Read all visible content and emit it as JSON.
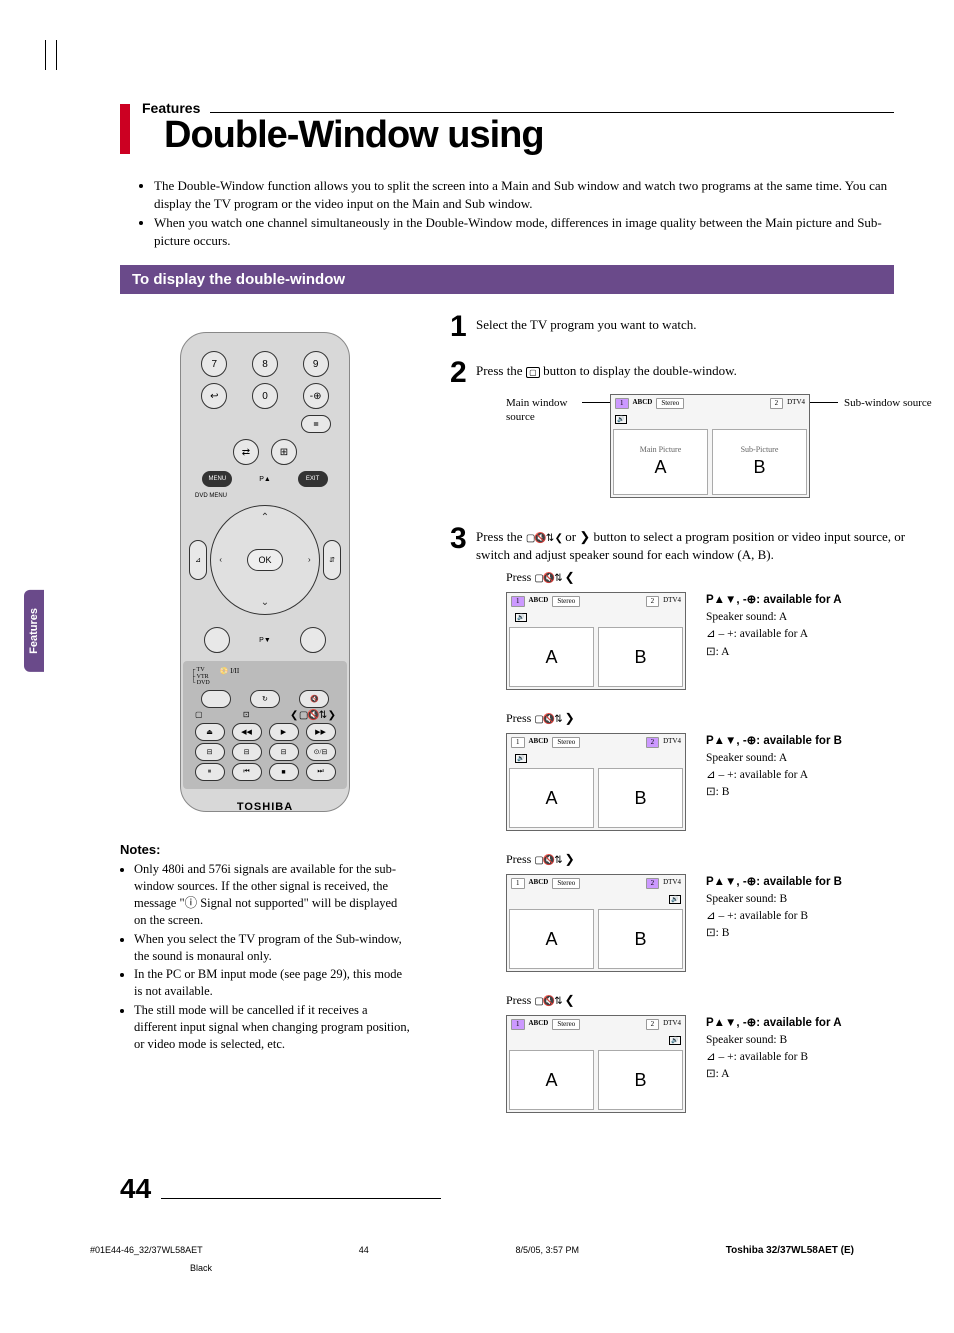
{
  "header": {
    "section_label": "Features",
    "title": "Double-Window using"
  },
  "intro_bullets": [
    "The Double-Window function allows you to split the screen into a Main and Sub window and watch two programs at the same time. You can display the TV program or the video input on the Main and Sub window.",
    "When you watch one channel simultaneously in the Double-Window mode, differences in image quality between the Main picture and Sub-picture occurs."
  ],
  "subheading": "To display the double-window",
  "side_tab": "Features",
  "remote": {
    "digits": [
      "7",
      "8",
      "9",
      "0"
    ],
    "menu": "MENU",
    "exit": "EXIT",
    "dvd_menu": "DVD MENU",
    "ok": "OK",
    "p_up": "P▲",
    "p_down": "P▼",
    "io": "I/II",
    "tv": "TV",
    "vtr": "VTR",
    "dvd": "DVD",
    "brand": "TOSHIBA"
  },
  "notes": {
    "title": "Notes:",
    "items": [
      "Only 480i and 576i signals are available for the sub-window sources. If the other signal is received, the message \"ⓘ Signal not supported\" will be displayed on the screen.",
      "When you select the TV program of the Sub-window, the sound is monaural only.",
      "In the PC or BM input mode (see page 29), this mode is not available.",
      "The still mode will be cancelled if it receives a different input signal when changing program position, or video mode is selected, etc."
    ]
  },
  "steps": {
    "s1": {
      "num": "1",
      "text": "Select the TV program you want to watch."
    },
    "s2": {
      "num": "2",
      "text_before": "Press the ",
      "text_after": " button to display the double-window."
    },
    "s3": {
      "num": "3",
      "text_before": "Press the ",
      "text_mid": " or ",
      "text_after": " button to select a program position or video input source, or switch and adjust speaker sound for each window (A, B)."
    }
  },
  "diagram": {
    "main_label": "Main window source",
    "sub_label": "Sub-window source",
    "main_pic": "Main Picture",
    "sub_pic": "Sub-Picture",
    "A": "A",
    "B": "B",
    "ch1": "1",
    "abcd": "ABCD",
    "stereo": "Stereo",
    "ch2": "2",
    "dtv4": "DTV4"
  },
  "states": [
    {
      "press_dir": "❮",
      "highlight_side": "left",
      "speaker_side": "left",
      "info": {
        "line1": "P▲▼, -⊕: available for A",
        "line2": "Speaker sound: A",
        "line3": "⊿ – +: available for A",
        "line4": "⊡: A"
      }
    },
    {
      "press_dir": "❯",
      "highlight_side": "right",
      "speaker_side": "left",
      "info": {
        "line1": "P▲▼, -⊕: available for B",
        "line2": "Speaker sound: A",
        "line3": "⊿ – +: available for A",
        "line4": "⊡: B"
      }
    },
    {
      "press_dir": "❯",
      "highlight_side": "right",
      "speaker_side": "right",
      "info": {
        "line1": "P▲▼, -⊕: available for B",
        "line2": "Speaker sound: B",
        "line3": "⊿ – +: available for B",
        "line4": "⊡: B"
      }
    },
    {
      "press_dir": "❮",
      "highlight_side": "left",
      "speaker_side": "right",
      "info": {
        "line1": "P▲▼, -⊕: available for A",
        "line2": "Speaker sound: B",
        "line3": "⊿ – +: available for B",
        "line4": "⊡: A"
      }
    }
  ],
  "press_label": "Press",
  "page_number": "44",
  "footer": {
    "left": "#01E44-46_32/37WL58AET",
    "left_sub": "Black",
    "center": "44",
    "date": "8/5/05, 3:57 PM",
    "right": "Toshiba 32/37WL58AET (E)"
  }
}
